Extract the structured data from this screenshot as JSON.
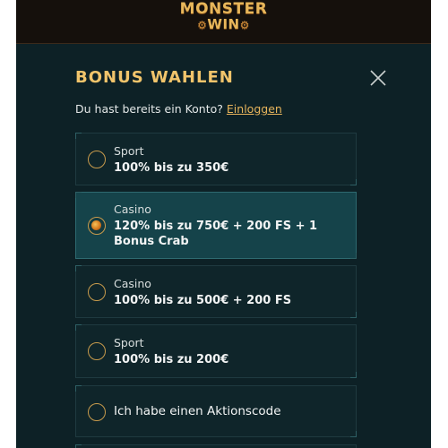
{
  "logo": {
    "line1": "MONSTER",
    "line2": "WIN"
  },
  "modal": {
    "title": "BONUS WAHLEN",
    "subtitle_text": "Du hast bereits ein Konto?",
    "login_link": "Einloggen"
  },
  "options": [
    {
      "type": "Sport",
      "title": "100% bis zu 350€",
      "selected": false
    },
    {
      "type": "Casino",
      "title": "120% bis zu 750€ + 200 FS + 1 Bonus Crab",
      "selected": true
    },
    {
      "type": "Casino",
      "title": "100% bis zu 500€ + 200 FS",
      "selected": false
    },
    {
      "type": "Sport",
      "title": "100% bis zu 200€",
      "selected": false
    }
  ],
  "promo_option": {
    "label": "Ich habe einen Aktionscode"
  },
  "colors": {
    "accent": "#f1c46b",
    "background": "#0d2126",
    "selected_bg": "#15434a"
  }
}
